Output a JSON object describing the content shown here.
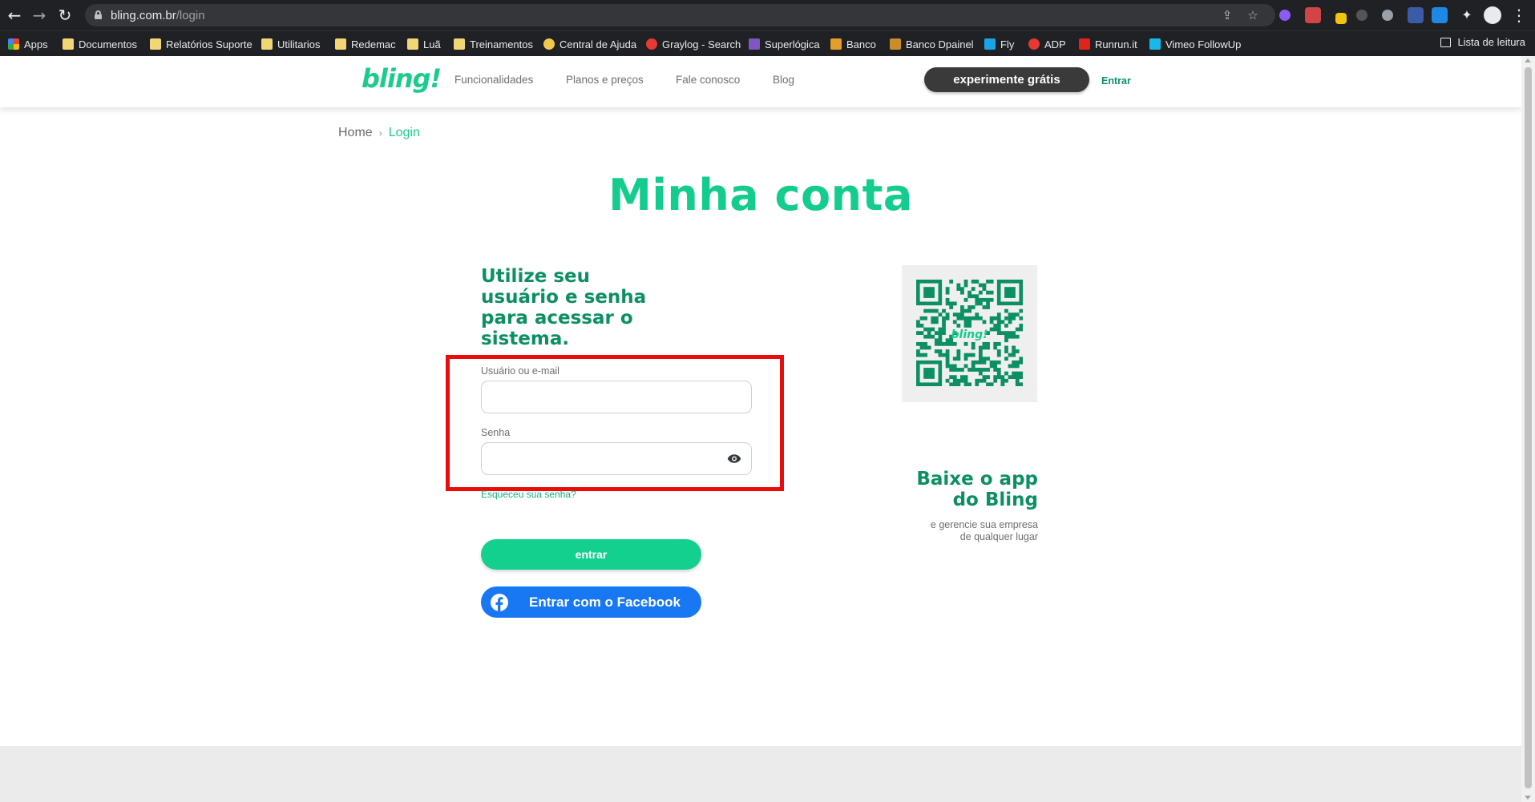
{
  "browser": {
    "url_host": "bling.com.br",
    "url_path": "/login",
    "bookmarks": [
      {
        "label": "Apps",
        "icon": "apps-grid-icon"
      },
      {
        "label": "Documentos",
        "icon": "folder-icon"
      },
      {
        "label": "Relatórios Suporte",
        "icon": "folder-icon"
      },
      {
        "label": "Utilitarios",
        "icon": "folder-icon"
      },
      {
        "label": "Redemac",
        "icon": "folder-icon"
      },
      {
        "label": "Luã",
        "icon": "folder-icon"
      },
      {
        "label": "Treinamentos",
        "icon": "folder-icon"
      },
      {
        "label": "Central de Ajuda",
        "icon": "help-icon"
      },
      {
        "label": "Graylog - Search",
        "icon": "graylog-icon"
      },
      {
        "label": "Superlógica",
        "icon": "superlogica-icon"
      },
      {
        "label": "Banco",
        "icon": "bank-icon"
      },
      {
        "label": "Banco Dpainel",
        "icon": "bank-icon"
      },
      {
        "label": "Fly",
        "icon": "fly-icon"
      },
      {
        "label": "ADP",
        "icon": "adp-icon"
      },
      {
        "label": "Runrun.it",
        "icon": "runrun-icon"
      },
      {
        "label": "Vimeo FollowUp",
        "icon": "vimeo-icon"
      }
    ],
    "reading_list": "Lista de leitura"
  },
  "header": {
    "logo": "bling!",
    "nav": [
      "Funcionalidades",
      "Planos e preços",
      "Fale conosco",
      "Blog"
    ],
    "cta": "experimente grátis",
    "login_link": "Entrar"
  },
  "breadcrumb": {
    "home": "Home",
    "separator": "›",
    "current": "Login"
  },
  "main": {
    "title": "Minha conta",
    "intro": "Utilize seu usuário e senha para acessar o sistema.",
    "username_label": "Usuário ou e-mail",
    "username_value": "",
    "password_label": "Senha",
    "password_value": "",
    "forgot": "Esqueceu sua senha?",
    "submit": "entrar",
    "facebook": "Entrar com o Facebook"
  },
  "app_promo": {
    "title_line1": "Baixe o app",
    "title_line2": "do Bling",
    "subtitle_line1": "e gerencie sua empresa",
    "subtitle_line2": "de qualquer lugar",
    "qr_label": "bling!"
  },
  "colors": {
    "brand_green": "#14cc8e",
    "dark_green": "#0b8f63",
    "facebook_blue": "#1877f2",
    "highlight_red": "#ea0b0b"
  }
}
